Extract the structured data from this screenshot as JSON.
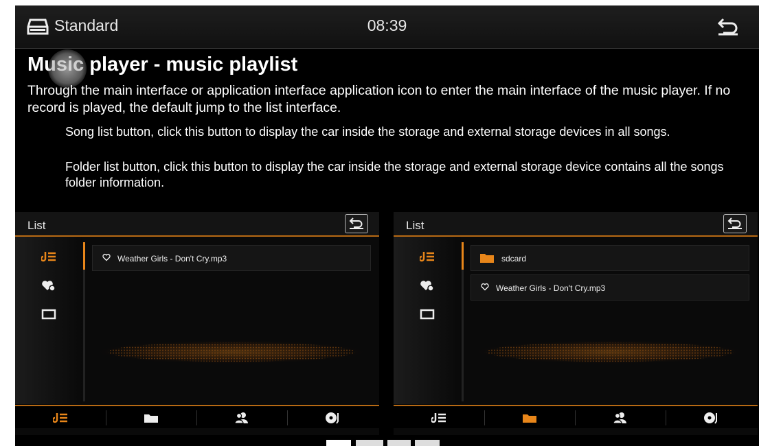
{
  "status": {
    "mode": "Standard",
    "time": "08:39"
  },
  "help": {
    "title": "Music player - music playlist",
    "intro": "Through the main interface or application interface application icon to enter the main interface of the music player. If no record is played, the default jump to the list interface.",
    "song_list_note": "Song list button, click this button to display the car inside the storage and external storage devices in all songs.",
    "folder_list_note": "Folder list button, click this button to display the car inside the storage and external storage device contains all the songs folder information."
  },
  "left_panel": {
    "title": "List",
    "items": [
      {
        "icon": "heart-outline-icon",
        "label": "Weather Girls - Don't Cry.mp3"
      }
    ],
    "active_tab": "song-list"
  },
  "right_panel": {
    "title": "List",
    "items": [
      {
        "icon": "folder-icon",
        "label": "sdcard"
      },
      {
        "icon": "heart-outline-icon",
        "label": "Weather Girls - Don't Cry.mp3"
      }
    ],
    "active_tab": "folder-list"
  },
  "colors": {
    "accent": "#e8861a",
    "background": "#000000",
    "text": "#ffffff"
  }
}
